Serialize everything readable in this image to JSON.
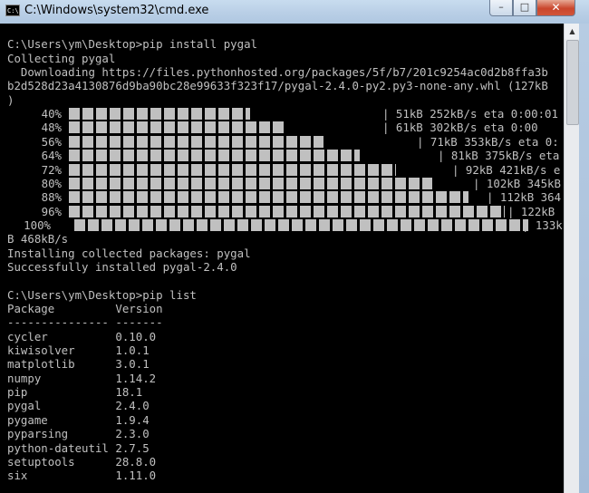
{
  "window": {
    "title": "C:\\Windows\\system32\\cmd.exe",
    "min_label": "–",
    "max_label": "□",
    "close_label": "✕"
  },
  "console": {
    "lines_top": [
      "",
      "C:\\Users\\ym\\Desktop>pip install pygal",
      "Collecting pygal",
      "  Downloading https://files.pythonhosted.org/packages/5f/b7/201c9254ac0d2b8ffa3b",
      "b2d528d23a4130876d9ba90bc28e99633f323f17/pygal-2.4.0-py2.py3-none-any.whl (127kB",
      ")"
    ],
    "progress": [
      {
        "pct": "40%",
        "fraction": 0.4,
        "tail": "| 51kB 252kB/s eta 0:00:01"
      },
      {
        "pct": "48%",
        "fraction": 0.48,
        "tail": "| 61kB 302kB/s eta 0:00"
      },
      {
        "pct": "56%",
        "fraction": 0.56,
        "tail": "| 71kB 353kB/s eta 0:"
      },
      {
        "pct": "64%",
        "fraction": 0.64,
        "tail": "| 81kB 375kB/s eta"
      },
      {
        "pct": "72%",
        "fraction": 0.72,
        "tail": "| 92kB 421kB/s e"
      },
      {
        "pct": "80%",
        "fraction": 0.8,
        "tail": "| 102kB 345kB"
      },
      {
        "pct": "88%",
        "fraction": 0.88,
        "tail": "| 112kB 364"
      },
      {
        "pct": "96%",
        "fraction": 0.96,
        "tail": "| 122kB"
      },
      {
        "pct": "100%",
        "fraction": 1.0,
        "tail": "| 133k"
      }
    ],
    "lines_bottom": [
      "B 468kB/s",
      "Installing collected packages: pygal",
      "Successfully installed pygal-2.4.0",
      "",
      "C:\\Users\\ym\\Desktop>pip list",
      "Package         Version",
      "--------------- -------",
      "cycler          0.10.0",
      "kiwisolver      1.0.1",
      "matplotlib      3.0.1",
      "numpy           1.14.2",
      "pip             18.1",
      "pygal           2.4.0",
      "pygame          1.9.4",
      "pyparsing       2.3.0",
      "python-dateutil 2.7.5",
      "setuptools      28.8.0",
      "six             1.11.0"
    ]
  },
  "scrollbar": {
    "up_arrow": "▲"
  },
  "colors": {
    "console_bg": "#000000",
    "console_fg": "#c0c0c0",
    "close_button": "#c9462c"
  }
}
